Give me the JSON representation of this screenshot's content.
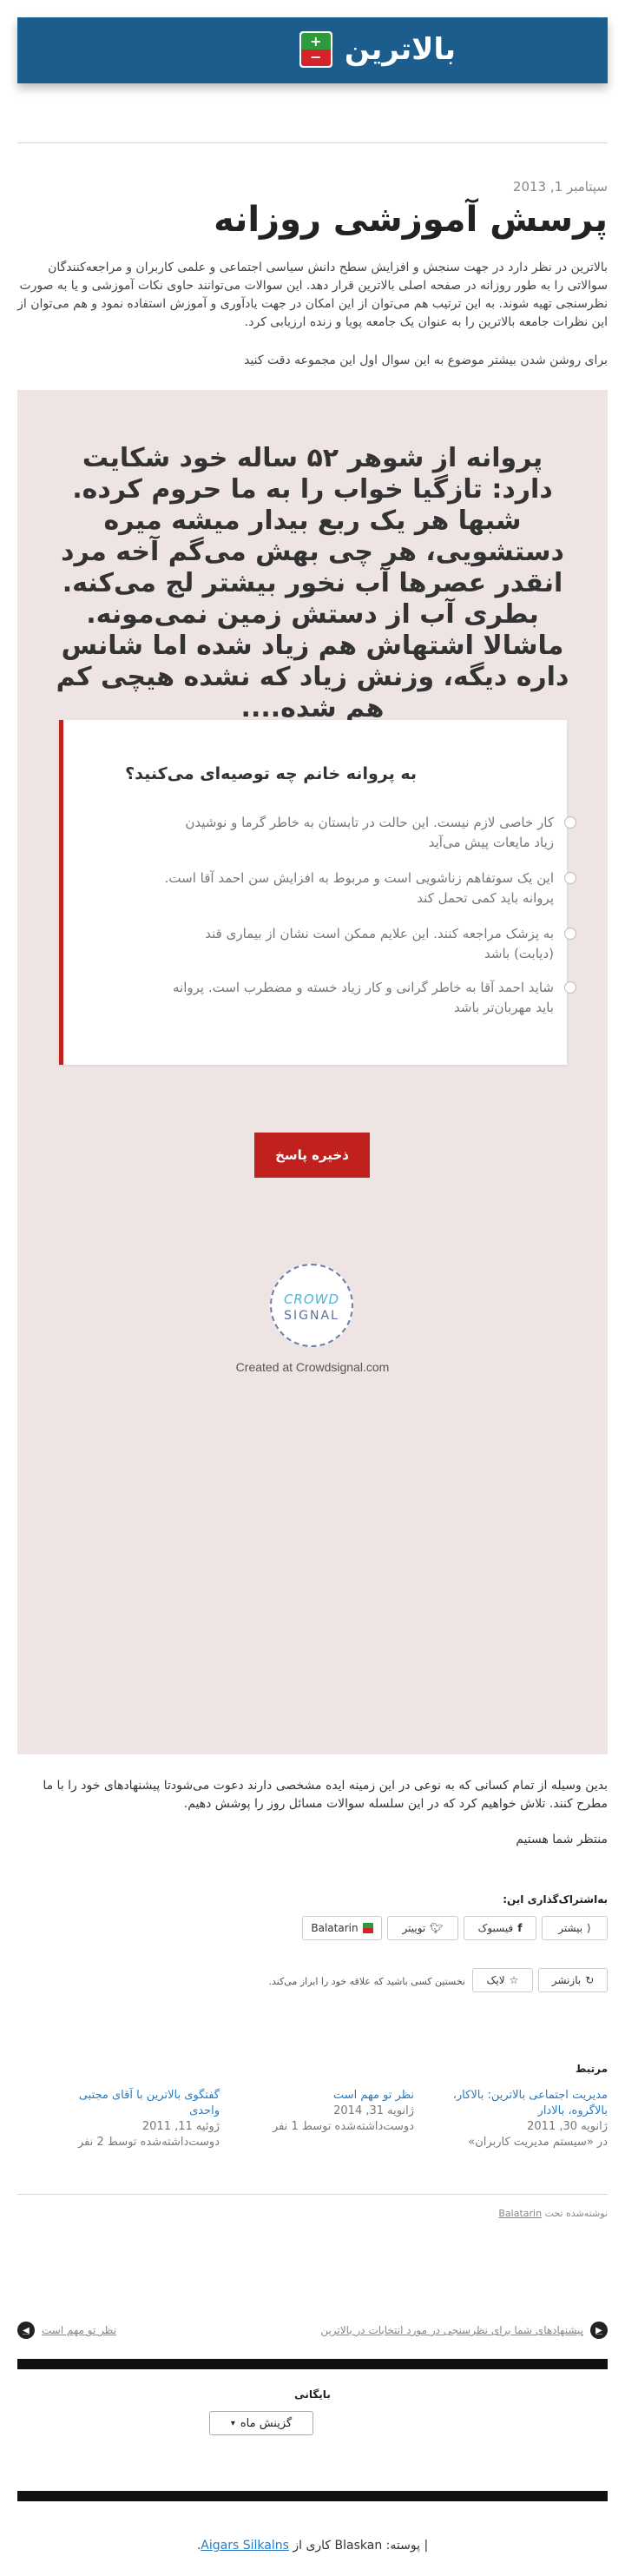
{
  "header": {
    "logo_text": "بالاترین",
    "badge_plus": "+",
    "badge_minus": "−"
  },
  "post": {
    "date": "سپتامبر 1, 2013",
    "title": "پرسش آموزشی روزانه",
    "intro_1": "بالاترین  در  نظر دارد در جهت سنجش و افزایش سطح دانش سیاسی اجتماعی و علمی کاربران و مراجعه‌کنندگان سوالاتی را به طور روزانه در صفحه اصلی بالاترین قرار دهد. این سوالات می‌توانند حاوی نکات آموزشی و یا به صورت نظرسنجی تهیه شوند. به این ترتیب هم می‌توان از این امکان در جهت یادآوری و آموزش استفاده نمود و هم می‌توان از این نظرات جامعه بالاترین را به عنوان یک جامعه پویا و زنده ارزیابی کرد.",
    "intro_2": "برای روشن شدن بیشتر موضوع به این سوال اول این مجموعه دقت کنید"
  },
  "poll": {
    "question": "پروانه از شوهر ۵۲ ساله خود شکایت دارد: تازگیا خواب را به ما حروم کرده. شبها هر یک ربع بیدار میشه میره دستشویی، هر چی بهش می‌گم آخه مرد انقدر عصرها آب نخور بیشتر لج می‌کنه. بطری آب از دستش زمین نمی‌مونه. ماشالا اشتهاش هم زیاد شده اما شانس داره دیگه، وزنش زیاد که نشده هیچی کم هم شده....",
    "card_question": "به پروانه خانم چه توصیه‌ای می‌کنید؟",
    "options": [
      "کار خاصی لازم نیست. این حالت در تابستان به خاطر گرما و نوشیدن زیاد مایعات پیش می‌آید",
      "این یک سوتفاهم زناشویی است و مربوط به افزایش سن احمد آقا است. پروانه باید کمی تحمل کند",
      "به پزشک مراجعه کنند. این علایم ممکن است نشان از بیماری قند (دیابت) باشد",
      "شاید احمد آقا به خاطر گرانی و کار زیاد خسته و مضطرب است. پروانه باید مهربان‌تر باشد"
    ],
    "save_label": "ذخیره پاسخ",
    "brand_line1": "CROWD",
    "brand_line2": "SIGNAL",
    "credit": "Created at Crowdsignal.com"
  },
  "after": {
    "text_1": "بدین وسیله از تمام کسانی که به نوعی در این زمینه ایده مشخصی دارند دعوت می‌شودتا پیشنهادهای خود را با ما مطرح کنند. تلاش خواهیم کرد که در این سلسله سوالات مسائل روز را پوشش دهیم.",
    "text_2": "منتظر شما هستیم"
  },
  "share": {
    "title": "به‌اشتراک‌گذاری این:",
    "more": "بیشتر",
    "facebook": "فیسبوک",
    "twitter": "توییتر",
    "balatarin": "Balatarin",
    "reblog": "بازنشر",
    "like": "لایک",
    "like_note": "نخستین کسی باشید که علاقه خود را ابراز می‌کند."
  },
  "related": {
    "title": "مرتبط",
    "items": [
      {
        "title": "مدیریت اجتماعی بالاترین: بالاکار، بالاگروه، بالادار",
        "date": "ژانویه 30, 2011",
        "meta": "در «سیستم مدیریت کاربران»"
      },
      {
        "title": "نظر تو مهم است",
        "date": "ژانویه 31, 2014",
        "meta": "دوست‌داشته‌شده توسط 1 نفر"
      },
      {
        "title": "گفتگوی بالاترین با آقای مجتبی واحدی",
        "date": "ژوئیه 11, 2011",
        "meta": "دوست‌داشته‌شده توسط 2 نفر"
      }
    ]
  },
  "tagline": {
    "prefix": "نوشته‌شده تحت",
    "tag": "Balatarin"
  },
  "nav": {
    "prev": "پیشنهادهای شما برای نظرسنجی در مورد انتخابات در بالاترین",
    "next": "نظر تو مهم است"
  },
  "archive": {
    "title": "بایگانی",
    "select_label": "گزینش ماه"
  },
  "footer": {
    "prefix": "| پوسته: Blaskan کاری از",
    "author": "Aigars Silkalns",
    "suffix": "."
  }
}
